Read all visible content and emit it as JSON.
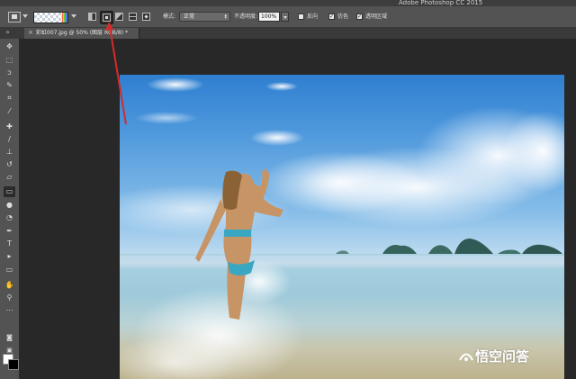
{
  "window": {
    "title": "Adobe Photoshop CC 2015"
  },
  "options_bar": {
    "mode_label": "模式:",
    "mode_value": "正常",
    "opacity_label": "不透明度:",
    "opacity_value": "100%",
    "reverse_label": "反向",
    "dither_label": "仿色",
    "transparency_label": "透明区域",
    "reverse_checked": false,
    "dither_checked": true,
    "transparency_checked": true,
    "selected_gradient_type": "radial"
  },
  "document_tab": {
    "name": "彩虹007.jpg @ 50% (图层 RGB/8) *",
    "close_glyph": "×"
  },
  "toolbar": {
    "tools": [
      {
        "name": "move",
        "glyph": "✥"
      },
      {
        "name": "marquee",
        "glyph": "⬚"
      },
      {
        "name": "lasso",
        "glyph": "ↄ"
      },
      {
        "name": "quick-select",
        "glyph": "✎"
      },
      {
        "name": "crop",
        "glyph": "⌗"
      },
      {
        "name": "eyedropper",
        "glyph": "⁄"
      },
      {
        "name": "healing",
        "glyph": "✚"
      },
      {
        "name": "brush",
        "glyph": "/"
      },
      {
        "name": "stamp",
        "glyph": "⊥"
      },
      {
        "name": "history-brush",
        "glyph": "↺"
      },
      {
        "name": "eraser",
        "glyph": "▱"
      },
      {
        "name": "gradient",
        "glyph": "▭"
      },
      {
        "name": "blur",
        "glyph": "●"
      },
      {
        "name": "dodge",
        "glyph": "◔"
      },
      {
        "name": "pen",
        "glyph": "✒"
      },
      {
        "name": "type",
        "glyph": "T"
      },
      {
        "name": "path-select",
        "glyph": "▸"
      },
      {
        "name": "rectangle",
        "glyph": "▭"
      },
      {
        "name": "hand",
        "glyph": "✋"
      },
      {
        "name": "zoom",
        "glyph": "⚲"
      },
      {
        "name": "more",
        "glyph": "⋯"
      }
    ],
    "active_tool": "gradient"
  },
  "watermark": {
    "text": "悟空问答"
  },
  "colors": {
    "annotation_arrow": "#d62a2a",
    "panel": "#535353",
    "canvas_bg": "#282828"
  }
}
